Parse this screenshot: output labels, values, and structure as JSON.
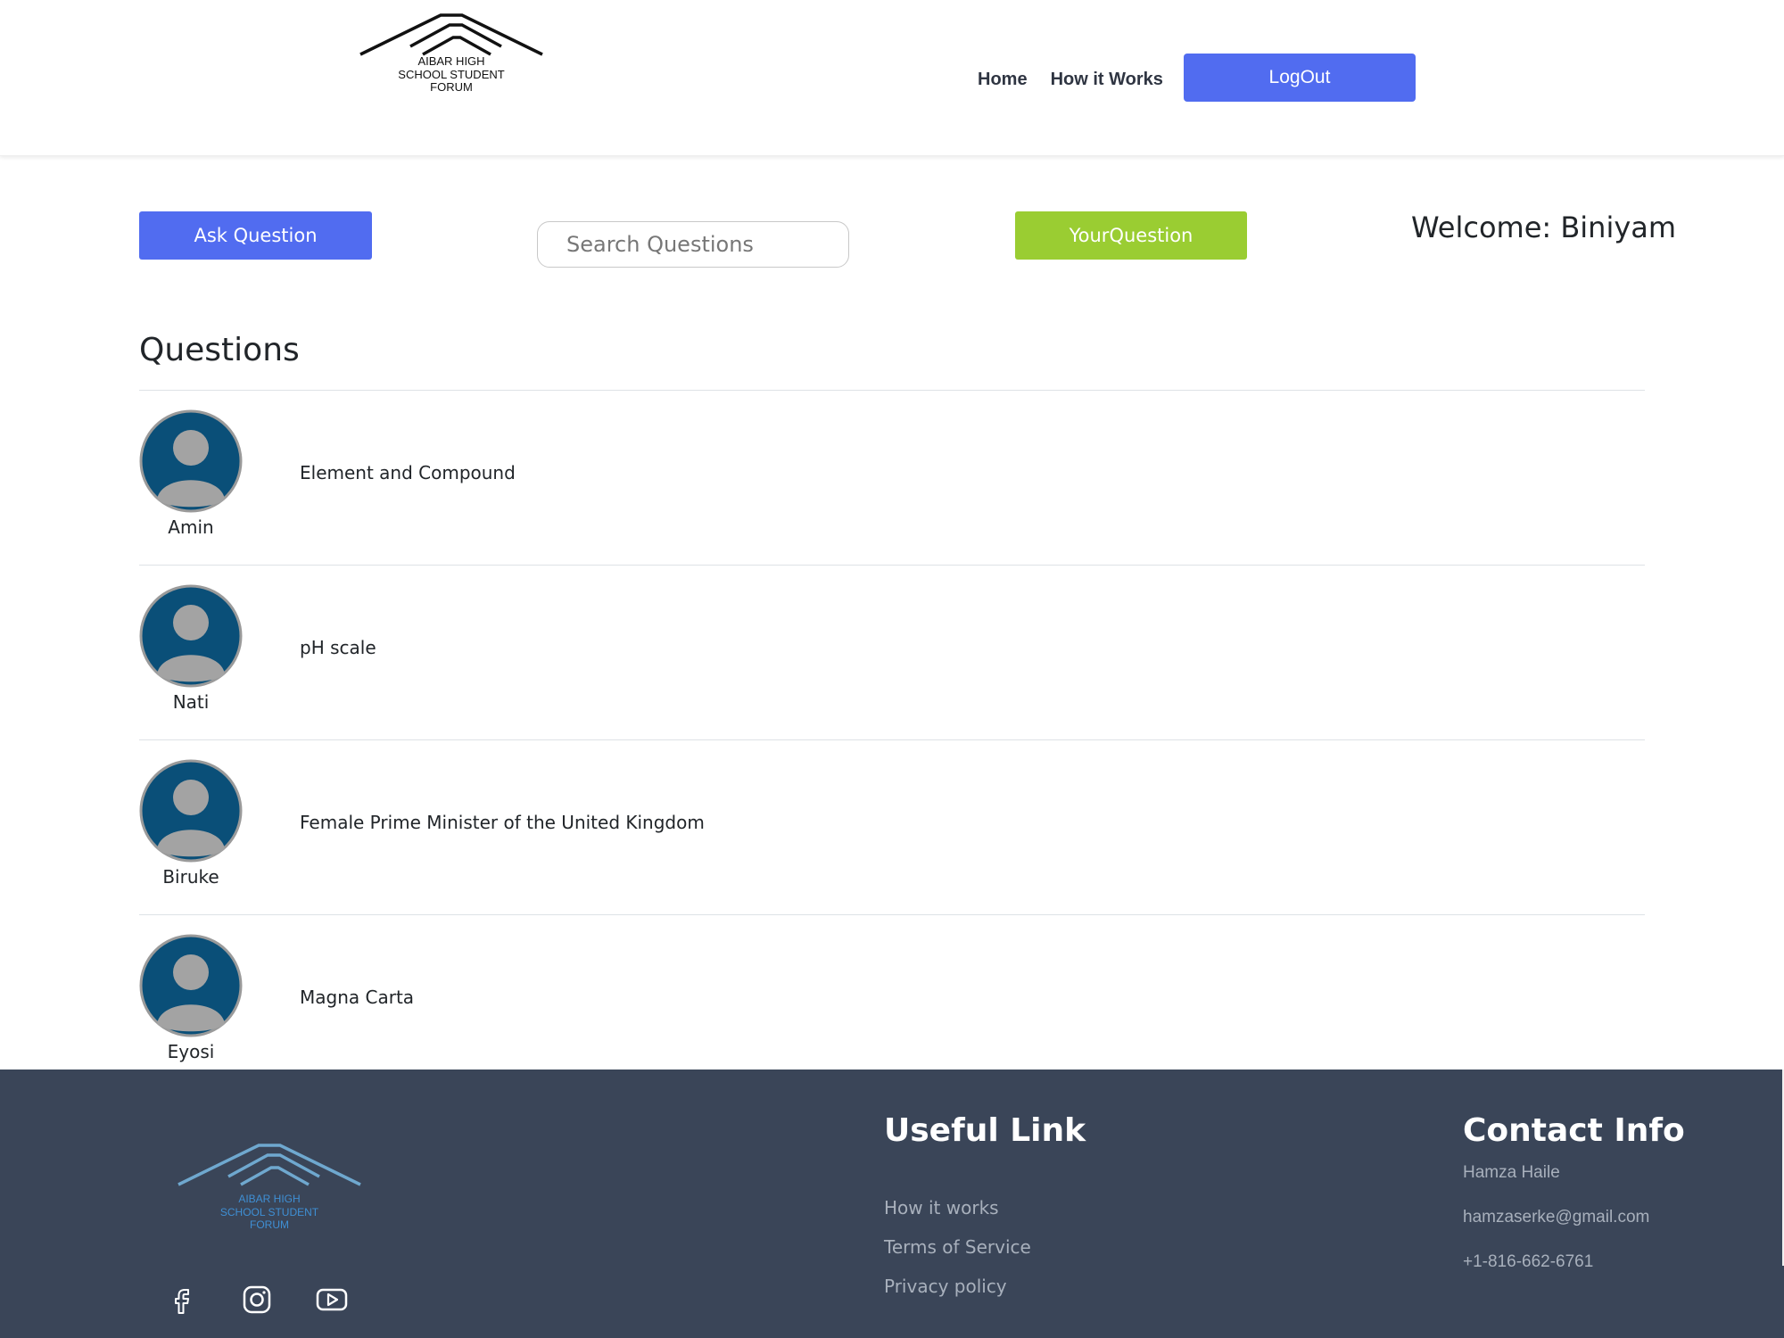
{
  "header": {
    "logo_lines": [
      "AIBAR HIGH",
      "SCHOOL STUDENT",
      "FORUM"
    ],
    "nav": [
      {
        "label": "Home"
      },
      {
        "label": "How it Works"
      }
    ],
    "logout_label": "LogOut"
  },
  "toolbar": {
    "ask_label": "Ask Question",
    "search_placeholder": "Search Questions",
    "search_value": "",
    "your_question_label": "YourQuestion",
    "welcome_text": "Welcome: Biniyam"
  },
  "questions": {
    "heading": "Questions",
    "items": [
      {
        "user": "Amin",
        "title": "Element and Compound"
      },
      {
        "user": "Nati",
        "title": "pH scale"
      },
      {
        "user": "Biruke",
        "title": "Female Prime Minister of the United Kingdom"
      },
      {
        "user": "Eyosi",
        "title": "Magna Carta"
      }
    ]
  },
  "footer": {
    "logo_lines": [
      "AIBAR HIGH",
      "SCHOOL STUDENT",
      "FORUM"
    ],
    "social_icons": [
      "facebook-icon",
      "instagram-icon",
      "youtube-icon"
    ],
    "useful_title": "Useful Link",
    "useful_links": [
      "How it works",
      "Terms of Service",
      "Privacy policy"
    ],
    "contact_title": "Contact Info",
    "contact_lines": [
      "Hamza Haile",
      "hamzaserke@gmail.com",
      "+1-816-662-6761"
    ]
  },
  "colors": {
    "primary_blue": "#516cf0",
    "green": "#9acd32",
    "footer_bg": "#3a4558",
    "avatar_bg": "#0a4f78"
  }
}
